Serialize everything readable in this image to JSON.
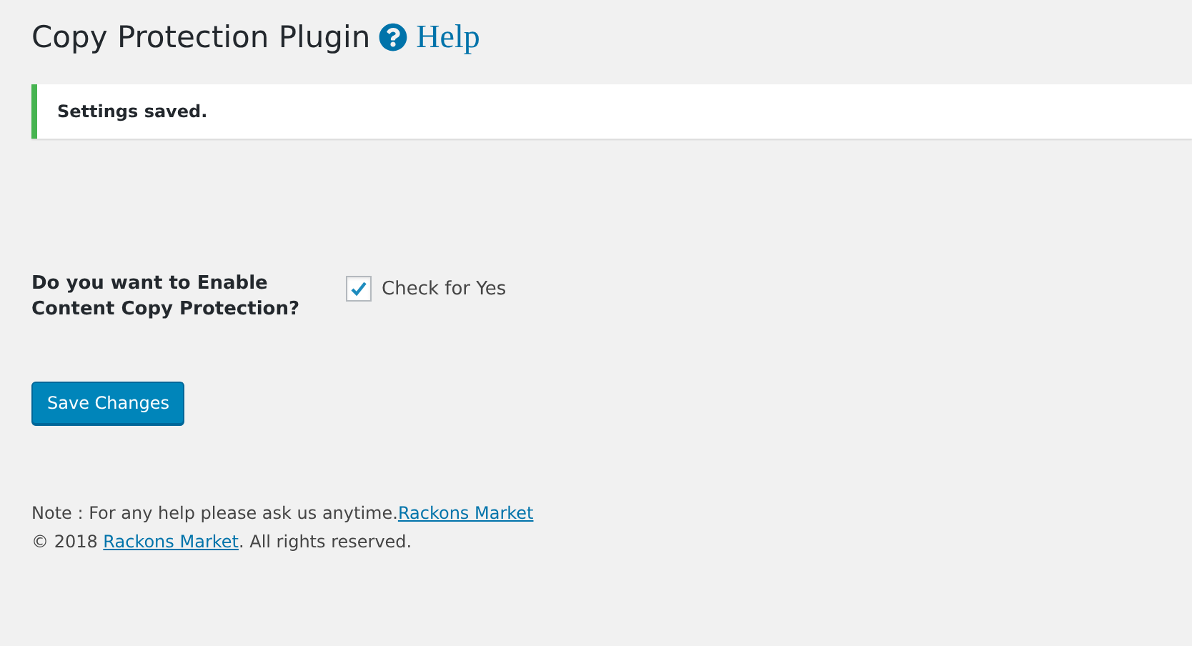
{
  "title": "Copy Protection Plugin",
  "help_link": "Help",
  "notice": {
    "text": "Settings saved."
  },
  "setting": {
    "label": "Do you want to Enable Content Copy Protection?",
    "checkbox_label": "Check for Yes",
    "checked": true
  },
  "save_button": "Save Changes",
  "note": {
    "text": "Note : For any help please ask us anytime.",
    "link": "Rackons Market"
  },
  "copyright": {
    "before": "© 2018 ",
    "link": "Rackons Market",
    "after": ". All rights reserved."
  }
}
